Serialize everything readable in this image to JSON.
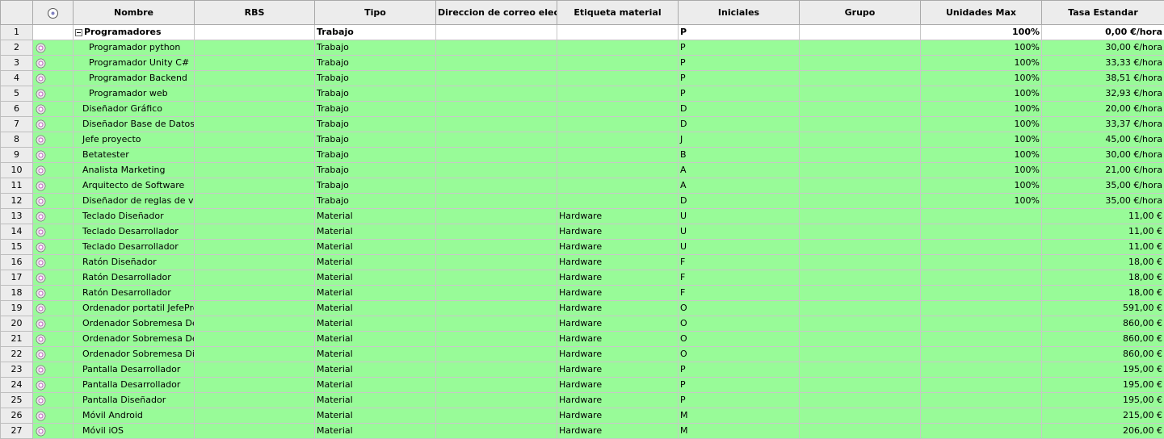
{
  "columns": {
    "nombre": "Nombre",
    "rbs": "RBS",
    "tipo": "Tipo",
    "correo": "Direccion de correo elec…",
    "etiqueta": "Etiqueta material",
    "iniciales": "Iniciales",
    "grupo": "Grupo",
    "unidades": "Unidades Max",
    "tasa": "Tasa Estandar"
  },
  "rows": [
    {
      "n": "1",
      "name": "Programadores",
      "tipo": "Trabajo",
      "etiqueta": "",
      "ini": "P",
      "uni": "100%",
      "tasa": "0,00 €/hora"
    },
    {
      "n": "2",
      "name": "Programador python",
      "tipo": "Trabajo",
      "etiqueta": "",
      "ini": "P",
      "uni": "100%",
      "tasa": "30,00 €/hora"
    },
    {
      "n": "3",
      "name": "Programador Unity C#",
      "tipo": "Trabajo",
      "etiqueta": "",
      "ini": "P",
      "uni": "100%",
      "tasa": "33,33 €/hora"
    },
    {
      "n": "4",
      "name": "Programador Backend",
      "tipo": "Trabajo",
      "etiqueta": "",
      "ini": "P",
      "uni": "100%",
      "tasa": "38,51 €/hora"
    },
    {
      "n": "5",
      "name": "Programador web",
      "tipo": "Trabajo",
      "etiqueta": "",
      "ini": "P",
      "uni": "100%",
      "tasa": "32,93 €/hora"
    },
    {
      "n": "6",
      "name": "Diseñador Gráfico",
      "tipo": "Trabajo",
      "etiqueta": "",
      "ini": "D",
      "uni": "100%",
      "tasa": "20,00 €/hora"
    },
    {
      "n": "7",
      "name": "Diseñador Base de Datos",
      "tipo": "Trabajo",
      "etiqueta": "",
      "ini": "D",
      "uni": "100%",
      "tasa": "33,37 €/hora"
    },
    {
      "n": "8",
      "name": "Jefe proyecto",
      "tipo": "Trabajo",
      "etiqueta": "",
      "ini": "J",
      "uni": "100%",
      "tasa": "45,00 €/hora"
    },
    {
      "n": "9",
      "name": "Betatester",
      "tipo": "Trabajo",
      "etiqueta": "",
      "ini": "B",
      "uni": "100%",
      "tasa": "30,00 €/hora"
    },
    {
      "n": "10",
      "name": "Analista Marketing",
      "tipo": "Trabajo",
      "etiqueta": "",
      "ini": "A",
      "uni": "100%",
      "tasa": "21,00 €/hora"
    },
    {
      "n": "11",
      "name": "Arquitecto de Software",
      "tipo": "Trabajo",
      "etiqueta": "",
      "ini": "A",
      "uni": "100%",
      "tasa": "35,00 €/hora"
    },
    {
      "n": "12",
      "name": "Diseñador de reglas de videc",
      "tipo": "Trabajo",
      "etiqueta": "",
      "ini": "D",
      "uni": "100%",
      "tasa": "35,00 €/hora"
    },
    {
      "n": "13",
      "name": "Teclado Diseñador",
      "tipo": "Material",
      "etiqueta": "Hardware",
      "ini": "U",
      "uni": "",
      "tasa": "11,00 €"
    },
    {
      "n": "14",
      "name": "Teclado Desarrollador",
      "tipo": "Material",
      "etiqueta": "Hardware",
      "ini": "U",
      "uni": "",
      "tasa": "11,00 €"
    },
    {
      "n": "15",
      "name": "Teclado Desarrollador",
      "tipo": "Material",
      "etiqueta": "Hardware",
      "ini": "U",
      "uni": "",
      "tasa": "11,00 €"
    },
    {
      "n": "16",
      "name": "Ratón Diseñador",
      "tipo": "Material",
      "etiqueta": "Hardware",
      "ini": "F",
      "uni": "",
      "tasa": "18,00 €"
    },
    {
      "n": "17",
      "name": "Ratón Desarrollador",
      "tipo": "Material",
      "etiqueta": "Hardware",
      "ini": "F",
      "uni": "",
      "tasa": "18,00 €"
    },
    {
      "n": "18",
      "name": "Ratón Desarrollador",
      "tipo": "Material",
      "etiqueta": "Hardware",
      "ini": "F",
      "uni": "",
      "tasa": "18,00 €"
    },
    {
      "n": "19",
      "name": "Ordenador portatil JefeProje",
      "tipo": "Material",
      "etiqueta": "Hardware",
      "ini": "O",
      "uni": "",
      "tasa": "591,00 €"
    },
    {
      "n": "20",
      "name": "Ordenador Sobremesa Desar",
      "tipo": "Material",
      "etiqueta": "Hardware",
      "ini": "O",
      "uni": "",
      "tasa": "860,00 €"
    },
    {
      "n": "21",
      "name": "Ordenador Sobremesa Desar",
      "tipo": "Material",
      "etiqueta": "Hardware",
      "ini": "O",
      "uni": "",
      "tasa": "860,00 €"
    },
    {
      "n": "22",
      "name": "Ordenador Sobremesa Diseñ",
      "tipo": "Material",
      "etiqueta": "Hardware",
      "ini": "O",
      "uni": "",
      "tasa": "860,00 €"
    },
    {
      "n": "23",
      "name": "Pantalla Desarrollador",
      "tipo": "Material",
      "etiqueta": "Hardware",
      "ini": "P",
      "uni": "",
      "tasa": "195,00 €"
    },
    {
      "n": "24",
      "name": "Pantalla Desarrollador",
      "tipo": "Material",
      "etiqueta": "Hardware",
      "ini": "P",
      "uni": "",
      "tasa": "195,00 €"
    },
    {
      "n": "25",
      "name": "Pantalla Diseñador",
      "tipo": "Material",
      "etiqueta": "Hardware",
      "ini": "P",
      "uni": "",
      "tasa": "195,00 €"
    },
    {
      "n": "26",
      "name": "Móvil Android",
      "tipo": "Material",
      "etiqueta": "Hardware",
      "ini": "M",
      "uni": "",
      "tasa": "215,00 €"
    },
    {
      "n": "27",
      "name": "Móvil iOS",
      "tipo": "Material",
      "etiqueta": "Hardware",
      "ini": "M",
      "uni": "",
      "tasa": "206,00 €"
    }
  ],
  "colors": {
    "row_green": "#98fb98",
    "header_gray": "#ececec"
  },
  "icons": {
    "header": "resource-type-icon",
    "row": "resource-icon",
    "group": "collapse-box-icon"
  }
}
